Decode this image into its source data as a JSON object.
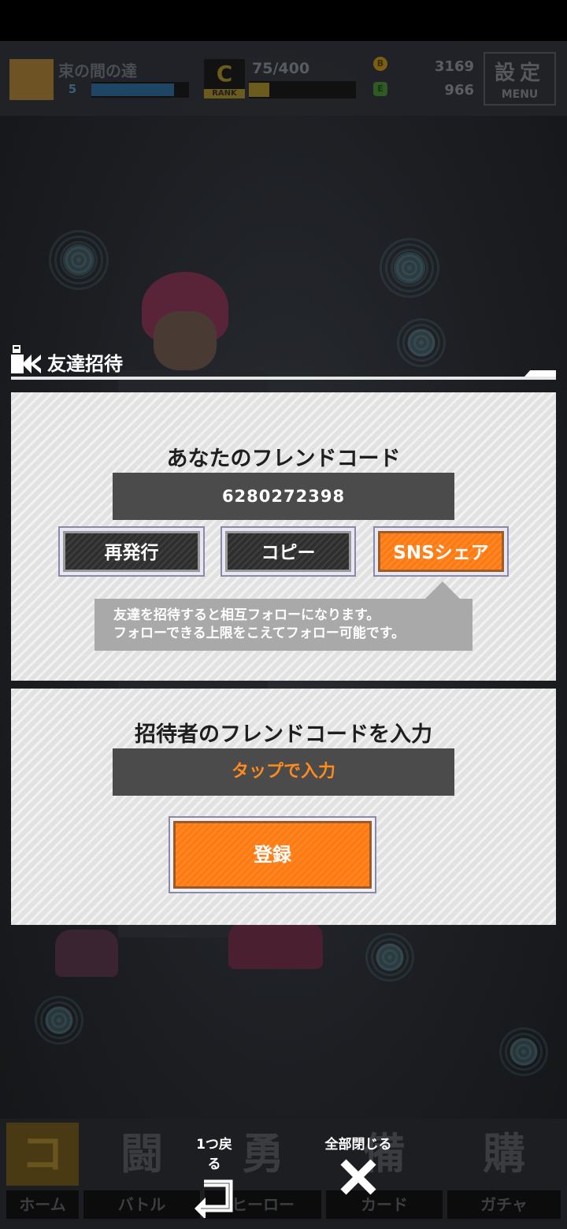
{
  "hud": {
    "player_name": "束の間の達",
    "level": "5",
    "rank_letter": "C",
    "rank_label": "RANK",
    "stamina": "75/400",
    "stamina_fraction": 0.19,
    "xp_fraction": 0.85,
    "coins": "3169",
    "gems": "966",
    "coin_symbol": "B",
    "gem_symbol": "E",
    "settings_label": "設定",
    "menu_label": "MENU"
  },
  "dialog": {
    "title": "友達招待",
    "my_code_title": "あなたのフレンドコード",
    "friend_code": "6280272398",
    "buttons": {
      "reissue": "再発行",
      "copy": "コピー",
      "sns_share": "SNSシェア"
    },
    "tooltip_line1": "友達を招待すると相互フォローになります。",
    "tooltip_line2": "フォローできる上限をこえてフォロー可能です。",
    "enter_code_title": "招待者のフレンドコードを入力",
    "input_placeholder": "タップで入力",
    "register": "登録"
  },
  "nav": {
    "home": "ホーム",
    "home_icon": "コ",
    "battle": "バトル",
    "battle_icon": "闘",
    "hero": "ヒーロー",
    "hero_icon": "勇",
    "card": "カード",
    "card_icon": "備",
    "gacha": "ガチャ",
    "gacha_icon": "購",
    "back_one": "1つ戻る",
    "close_all": "全部閉じる"
  },
  "colors": {
    "accent_orange": "#ff7a10",
    "panel_bg": "#e2e2e2",
    "code_box": "#4b4b4b",
    "placeholder_text": "#ff8a1e"
  }
}
